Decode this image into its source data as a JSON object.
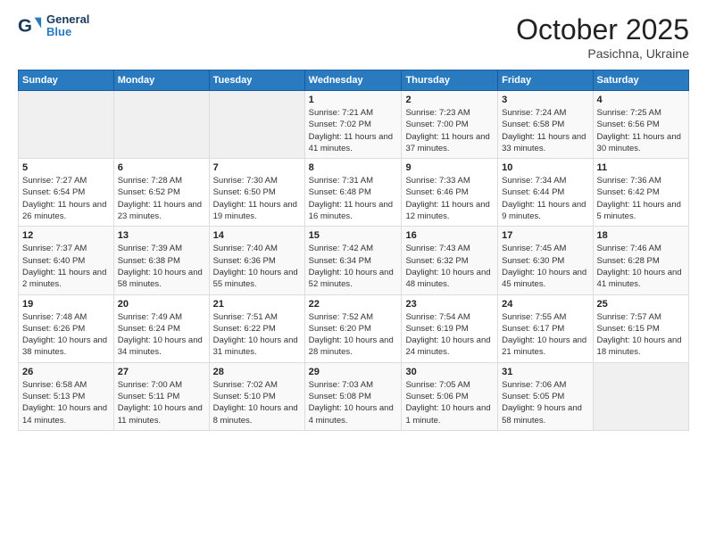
{
  "header": {
    "logo_text_general": "General",
    "logo_text_blue": "Blue",
    "month_title": "October 2025",
    "location": "Pasichna, Ukraine"
  },
  "days_of_week": [
    "Sunday",
    "Monday",
    "Tuesday",
    "Wednesday",
    "Thursday",
    "Friday",
    "Saturday"
  ],
  "weeks": [
    [
      {
        "num": "",
        "info": ""
      },
      {
        "num": "",
        "info": ""
      },
      {
        "num": "",
        "info": ""
      },
      {
        "num": "1",
        "info": "Sunrise: 7:21 AM\nSunset: 7:02 PM\nDaylight: 11 hours and 41 minutes."
      },
      {
        "num": "2",
        "info": "Sunrise: 7:23 AM\nSunset: 7:00 PM\nDaylight: 11 hours and 37 minutes."
      },
      {
        "num": "3",
        "info": "Sunrise: 7:24 AM\nSunset: 6:58 PM\nDaylight: 11 hours and 33 minutes."
      },
      {
        "num": "4",
        "info": "Sunrise: 7:25 AM\nSunset: 6:56 PM\nDaylight: 11 hours and 30 minutes."
      }
    ],
    [
      {
        "num": "5",
        "info": "Sunrise: 7:27 AM\nSunset: 6:54 PM\nDaylight: 11 hours and 26 minutes."
      },
      {
        "num": "6",
        "info": "Sunrise: 7:28 AM\nSunset: 6:52 PM\nDaylight: 11 hours and 23 minutes."
      },
      {
        "num": "7",
        "info": "Sunrise: 7:30 AM\nSunset: 6:50 PM\nDaylight: 11 hours and 19 minutes."
      },
      {
        "num": "8",
        "info": "Sunrise: 7:31 AM\nSunset: 6:48 PM\nDaylight: 11 hours and 16 minutes."
      },
      {
        "num": "9",
        "info": "Sunrise: 7:33 AM\nSunset: 6:46 PM\nDaylight: 11 hours and 12 minutes."
      },
      {
        "num": "10",
        "info": "Sunrise: 7:34 AM\nSunset: 6:44 PM\nDaylight: 11 hours and 9 minutes."
      },
      {
        "num": "11",
        "info": "Sunrise: 7:36 AM\nSunset: 6:42 PM\nDaylight: 11 hours and 5 minutes."
      }
    ],
    [
      {
        "num": "12",
        "info": "Sunrise: 7:37 AM\nSunset: 6:40 PM\nDaylight: 11 hours and 2 minutes."
      },
      {
        "num": "13",
        "info": "Sunrise: 7:39 AM\nSunset: 6:38 PM\nDaylight: 10 hours and 58 minutes."
      },
      {
        "num": "14",
        "info": "Sunrise: 7:40 AM\nSunset: 6:36 PM\nDaylight: 10 hours and 55 minutes."
      },
      {
        "num": "15",
        "info": "Sunrise: 7:42 AM\nSunset: 6:34 PM\nDaylight: 10 hours and 52 minutes."
      },
      {
        "num": "16",
        "info": "Sunrise: 7:43 AM\nSunset: 6:32 PM\nDaylight: 10 hours and 48 minutes."
      },
      {
        "num": "17",
        "info": "Sunrise: 7:45 AM\nSunset: 6:30 PM\nDaylight: 10 hours and 45 minutes."
      },
      {
        "num": "18",
        "info": "Sunrise: 7:46 AM\nSunset: 6:28 PM\nDaylight: 10 hours and 41 minutes."
      }
    ],
    [
      {
        "num": "19",
        "info": "Sunrise: 7:48 AM\nSunset: 6:26 PM\nDaylight: 10 hours and 38 minutes."
      },
      {
        "num": "20",
        "info": "Sunrise: 7:49 AM\nSunset: 6:24 PM\nDaylight: 10 hours and 34 minutes."
      },
      {
        "num": "21",
        "info": "Sunrise: 7:51 AM\nSunset: 6:22 PM\nDaylight: 10 hours and 31 minutes."
      },
      {
        "num": "22",
        "info": "Sunrise: 7:52 AM\nSunset: 6:20 PM\nDaylight: 10 hours and 28 minutes."
      },
      {
        "num": "23",
        "info": "Sunrise: 7:54 AM\nSunset: 6:19 PM\nDaylight: 10 hours and 24 minutes."
      },
      {
        "num": "24",
        "info": "Sunrise: 7:55 AM\nSunset: 6:17 PM\nDaylight: 10 hours and 21 minutes."
      },
      {
        "num": "25",
        "info": "Sunrise: 7:57 AM\nSunset: 6:15 PM\nDaylight: 10 hours and 18 minutes."
      }
    ],
    [
      {
        "num": "26",
        "info": "Sunrise: 6:58 AM\nSunset: 5:13 PM\nDaylight: 10 hours and 14 minutes."
      },
      {
        "num": "27",
        "info": "Sunrise: 7:00 AM\nSunset: 5:11 PM\nDaylight: 10 hours and 11 minutes."
      },
      {
        "num": "28",
        "info": "Sunrise: 7:02 AM\nSunset: 5:10 PM\nDaylight: 10 hours and 8 minutes."
      },
      {
        "num": "29",
        "info": "Sunrise: 7:03 AM\nSunset: 5:08 PM\nDaylight: 10 hours and 4 minutes."
      },
      {
        "num": "30",
        "info": "Sunrise: 7:05 AM\nSunset: 5:06 PM\nDaylight: 10 hours and 1 minute."
      },
      {
        "num": "31",
        "info": "Sunrise: 7:06 AM\nSunset: 5:05 PM\nDaylight: 9 hours and 58 minutes."
      },
      {
        "num": "",
        "info": ""
      }
    ]
  ]
}
